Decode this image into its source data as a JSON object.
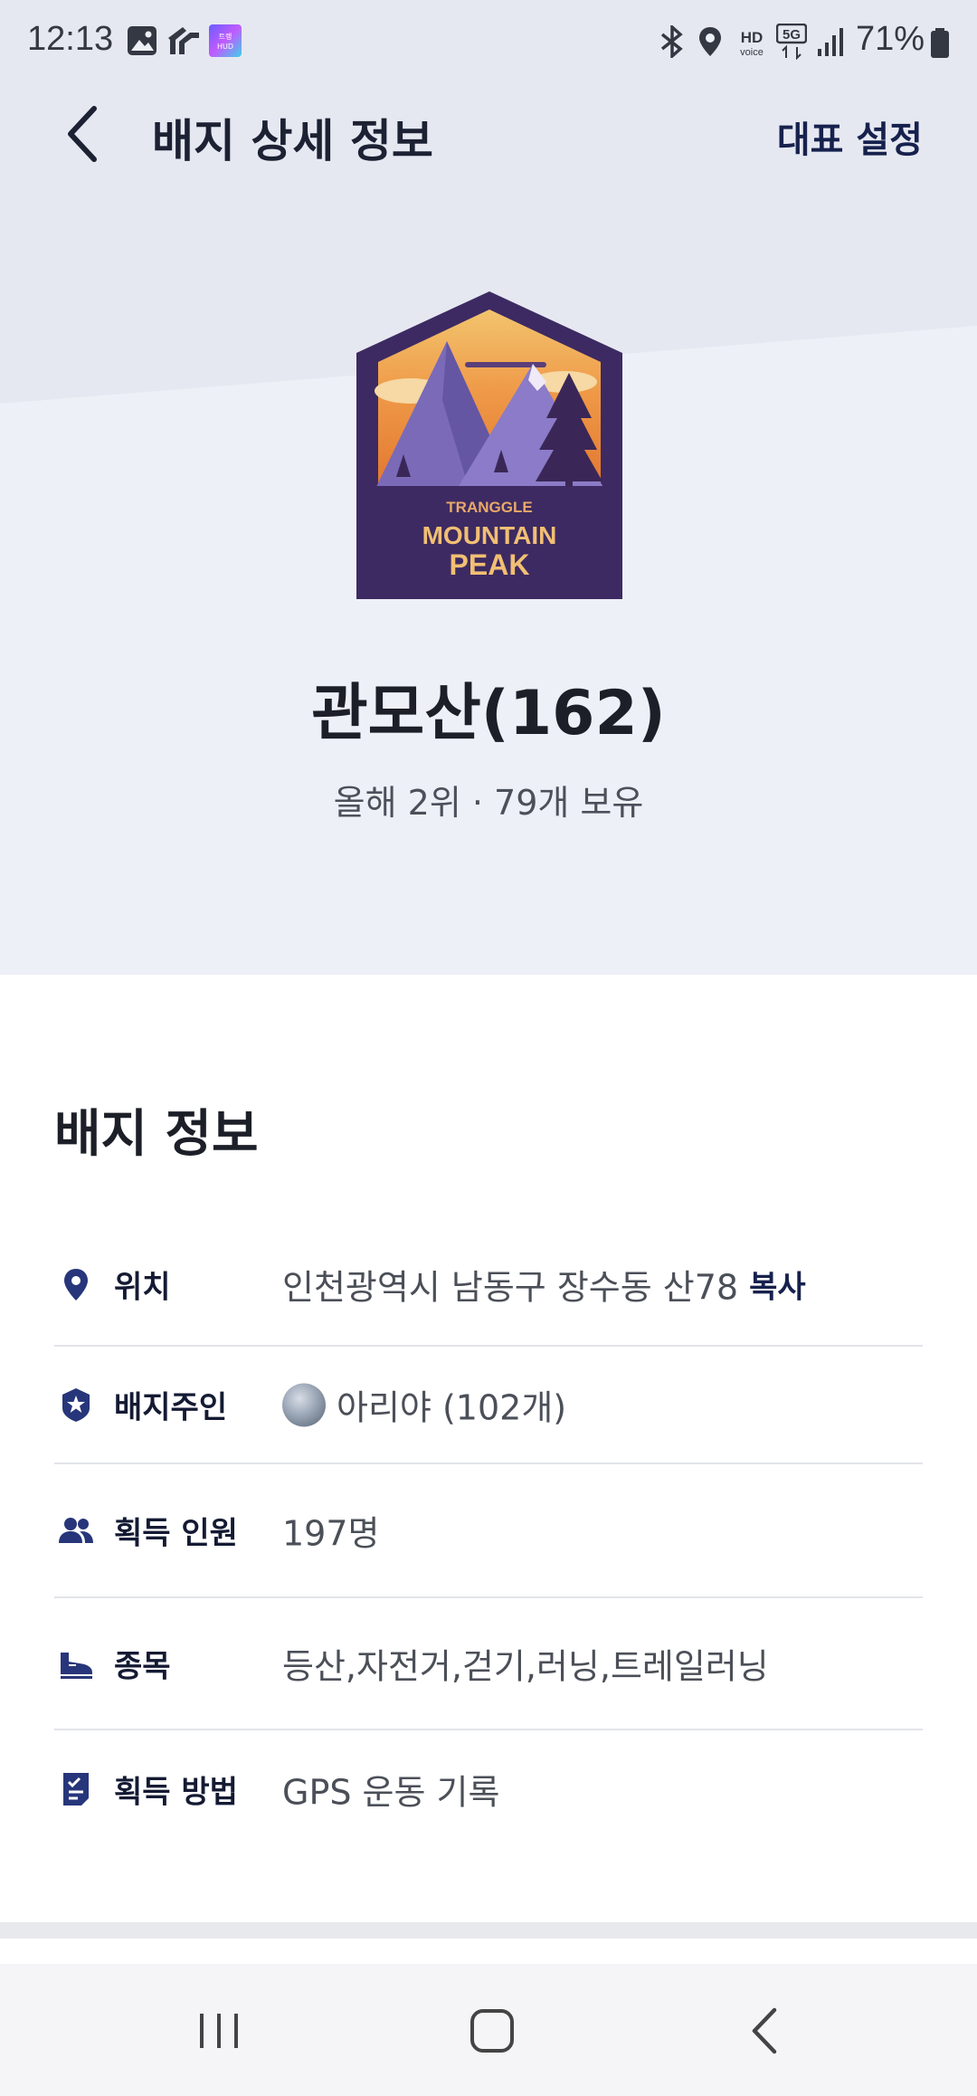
{
  "status_bar": {
    "time": "12:13",
    "battery_percent": "71%",
    "icons": [
      "gallery-icon",
      "app-icon",
      "hud-app-icon",
      "bluetooth-icon",
      "location-icon",
      "hd-voice-icon",
      "5g-icon",
      "signal-icon",
      "battery-icon"
    ]
  },
  "header": {
    "title": "배지 상세 정보",
    "action_label": "대표 설정"
  },
  "badge": {
    "brand_text": "TRANGGLE",
    "title_line1": "MOUNTAIN",
    "title_line2": "PEAK",
    "name": "관모산(162)",
    "subtitle": "올해 2위 · 79개 보유"
  },
  "info": {
    "section_title": "배지 정보",
    "rows": [
      {
        "icon": "location-pin-icon",
        "label": "위치",
        "value": "인천광역시 남동구 장수동 산78",
        "action": "복사"
      },
      {
        "icon": "star-shield-icon",
        "label": "배지주인",
        "value": "아리야 (102개)"
      },
      {
        "icon": "people-icon",
        "label": "획득 인원",
        "value": "197명"
      },
      {
        "icon": "shoe-icon",
        "label": "종목",
        "value": "등산,자전거,걷기,러닝,트레일러닝"
      },
      {
        "icon": "checklist-icon",
        "label": "획득 방법",
        "value": "GPS 운동 기록"
      }
    ]
  },
  "colors": {
    "hero_bg": "#eef0f7",
    "accent_navy": "#16214d",
    "icon_blue": "#27367a",
    "badge_purple": "#3e2b63",
    "badge_orange": "#e98c3e"
  }
}
